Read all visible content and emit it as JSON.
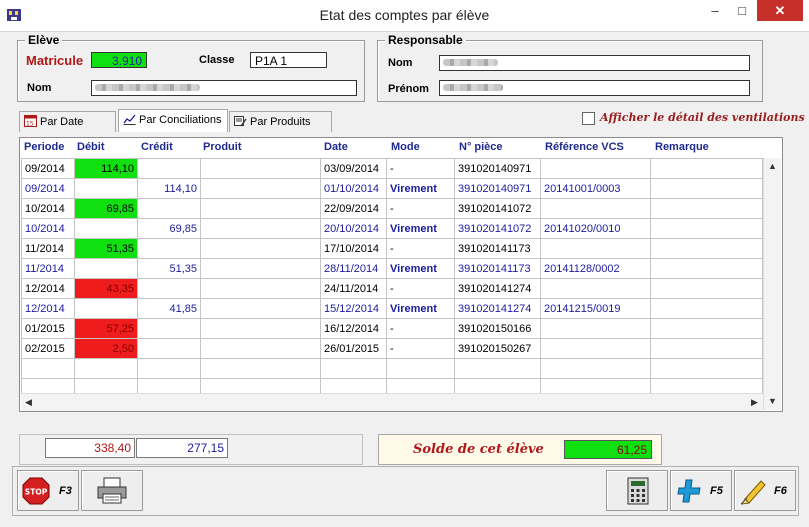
{
  "window": {
    "title": "Etat des comptes par élève",
    "minimize": "–",
    "maximize": "□",
    "close": "✕"
  },
  "eleve": {
    "legend": "Elève",
    "matricule_label": "Matricule",
    "matricule_value": "3.910",
    "classe_label": "Classe",
    "classe_value": "P1A 1",
    "nom_label": "Nom"
  },
  "responsable": {
    "legend": "Responsable",
    "nom_label": "Nom",
    "prenom_label": "Prénom"
  },
  "tabs": [
    {
      "label": "Par Date"
    },
    {
      "label": "Par Conciliations"
    },
    {
      "label": "Par Produits"
    }
  ],
  "options": {
    "show_ventilations_label": "Afficher le détail des ventilations"
  },
  "table": {
    "columns": [
      "Periode",
      "Débit",
      "Crédit",
      "Produit",
      "Date",
      "Mode",
      "N° pièce",
      "Référence VCS",
      "Remarque"
    ],
    "rows": [
      {
        "periode": "09/2014",
        "debit": "114,10",
        "credit": "",
        "produit": "",
        "date": "03/09/2014",
        "mode": "-",
        "piece": "391020140971",
        "ref": "",
        "remarque": "",
        "debit_status": "green",
        "style": "black"
      },
      {
        "periode": "09/2014",
        "debit": "",
        "credit": "114,10",
        "produit": "",
        "date": "01/10/2014",
        "mode": "Virement",
        "piece": "391020140971",
        "ref": "20141001/0003",
        "remarque": "",
        "debit_status": "",
        "style": "blue"
      },
      {
        "periode": "10/2014",
        "debit": "69,85",
        "credit": "",
        "produit": "",
        "date": "22/09/2014",
        "mode": "-",
        "piece": "391020141072",
        "ref": "",
        "remarque": "",
        "debit_status": "green",
        "style": "black"
      },
      {
        "periode": "10/2014",
        "debit": "",
        "credit": "69,85",
        "produit": "",
        "date": "20/10/2014",
        "mode": "Virement",
        "piece": "391020141072",
        "ref": "20141020/0010",
        "remarque": "",
        "debit_status": "",
        "style": "blue"
      },
      {
        "periode": "11/2014",
        "debit": "51,35",
        "credit": "",
        "produit": "",
        "date": "17/10/2014",
        "mode": "-",
        "piece": "391020141173",
        "ref": "",
        "remarque": "",
        "debit_status": "green",
        "style": "black"
      },
      {
        "periode": "11/2014",
        "debit": "",
        "credit": "51,35",
        "produit": "",
        "date": "28/11/2014",
        "mode": "Virement",
        "piece": "391020141173",
        "ref": "20141128/0002",
        "remarque": "",
        "debit_status": "",
        "style": "blue"
      },
      {
        "periode": "12/2014",
        "debit": "43,35",
        "credit": "",
        "produit": "",
        "date": "24/11/2014",
        "mode": "-",
        "piece": "391020141274",
        "ref": "",
        "remarque": "",
        "debit_status": "red",
        "style": "black"
      },
      {
        "periode": "12/2014",
        "debit": "",
        "credit": "41,85",
        "produit": "",
        "date": "15/12/2014",
        "mode": "Virement",
        "piece": "391020141274",
        "ref": "20141215/0019",
        "remarque": "",
        "debit_status": "",
        "style": "blue"
      },
      {
        "periode": "01/2015",
        "debit": "57,25",
        "credit": "",
        "produit": "",
        "date": "16/12/2014",
        "mode": "-",
        "piece": "391020150166",
        "ref": "",
        "remarque": "",
        "debit_status": "red",
        "style": "black"
      },
      {
        "periode": "02/2015",
        "debit": "2,50",
        "credit": "",
        "produit": "",
        "date": "26/01/2015",
        "mode": "-",
        "piece": "391020150267",
        "ref": "",
        "remarque": "",
        "debit_status": "red",
        "style": "black"
      }
    ]
  },
  "totals": {
    "debit": "338,40",
    "credit": "277,15"
  },
  "solde": {
    "label": "Solde de cet élève",
    "value": "61,25"
  },
  "toolbar": {
    "stop_text": "STOP",
    "stop_key": "F3",
    "add_key": "F5",
    "edit_key": "F6"
  },
  "colors": {
    "green": "#10e010",
    "red": "#ee1c1c",
    "blue_text": "#1c1c9e",
    "close_btn": "#c7302a"
  }
}
